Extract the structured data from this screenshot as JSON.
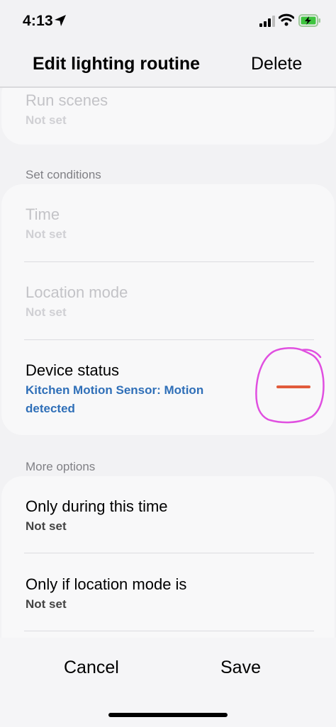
{
  "status_bar": {
    "time": "4:13"
  },
  "nav": {
    "title": "Edit lighting routine",
    "delete_label": "Delete"
  },
  "actions_card": {
    "run_scenes": {
      "title": "Run scenes",
      "value": "Not set"
    }
  },
  "conditions": {
    "section_label": "Set conditions",
    "time": {
      "title": "Time",
      "value": "Not set"
    },
    "location_mode": {
      "title": "Location mode",
      "value": "Not set"
    },
    "device_status": {
      "title": "Device status",
      "value_line1": "Kitchen Motion Sensor: Motion",
      "value_line2": "detected"
    }
  },
  "more_options": {
    "section_label": "More options",
    "only_during_time": {
      "title": "Only during this time",
      "value": "Not set"
    },
    "only_if_location_mode": {
      "title": "Only if location mode is",
      "value": "Not set"
    }
  },
  "bottom": {
    "cancel_label": "Cancel",
    "save_label": "Save"
  },
  "colors": {
    "accent_blue": "#2f6fb8",
    "remove_red": "#e15b3c",
    "annotation_pink": "#e04fe0"
  }
}
